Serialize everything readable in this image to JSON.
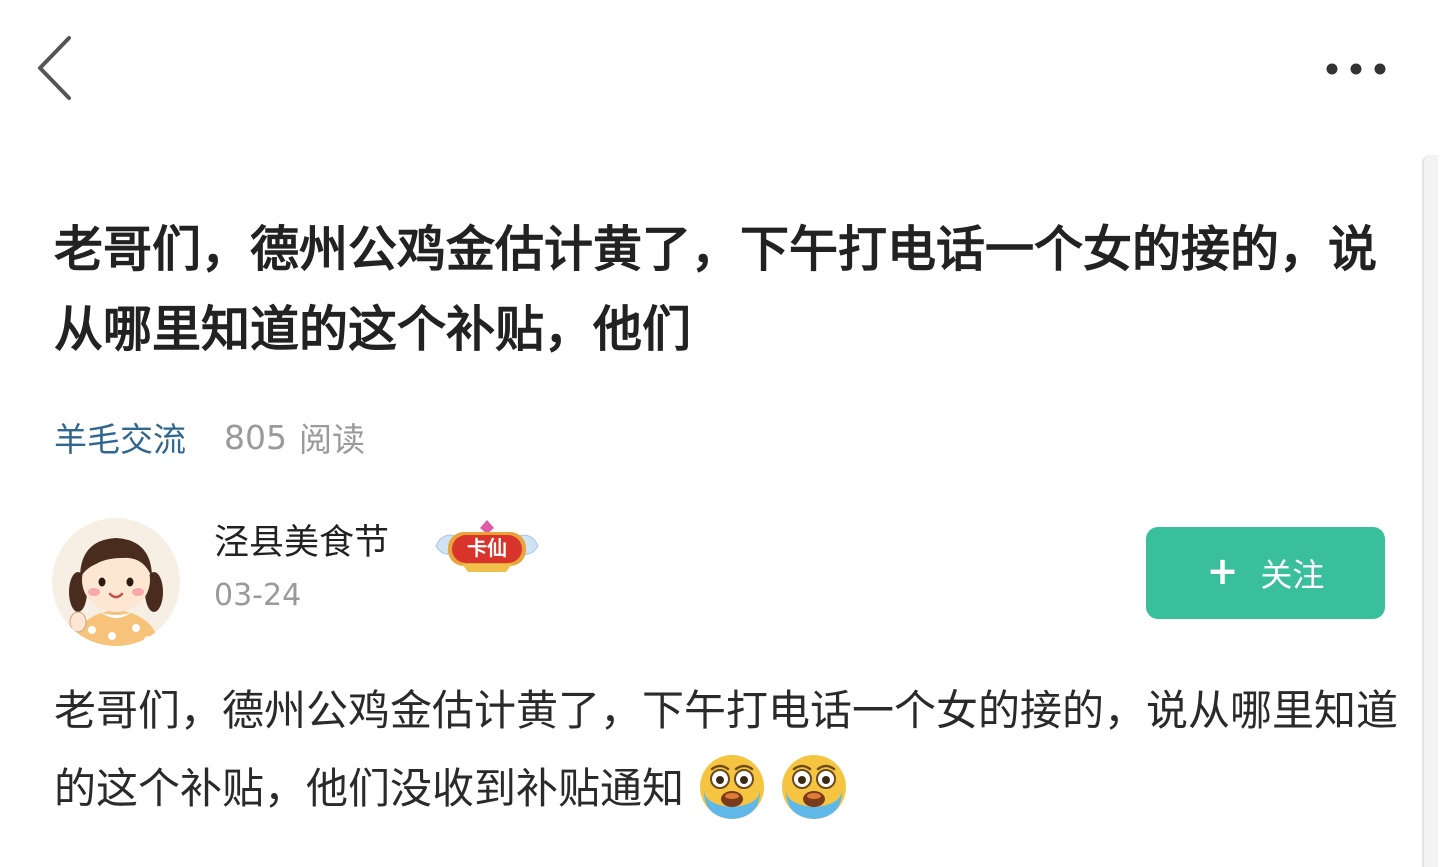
{
  "nav": {
    "back_icon": "chevron-left-icon",
    "more_icon": "more-horizontal-icon"
  },
  "post": {
    "title": "老哥们，德州公鸡金估计黄了，下午打电话一个女的接的，说从哪里知道的这个补贴，他们",
    "category": "羊毛交流",
    "read_count": "805",
    "read_label": "阅读",
    "body": "老哥们，德州公鸡金估计黄了，下午打电话一个女的接的，说从哪里知道的这个补贴，他们没收到补贴通知",
    "emojis": [
      "crying-emoji",
      "crying-emoji"
    ]
  },
  "author": {
    "name": "泾县美食节",
    "badge": "卡仙",
    "date": "03-24",
    "avatar_icon": "cartoon-girl-avatar"
  },
  "follow": {
    "label": "关注",
    "icon": "plus-icon"
  },
  "colors": {
    "accent": "#3abf9c",
    "category": "#2f6791",
    "muted": "#9a9a9a"
  }
}
